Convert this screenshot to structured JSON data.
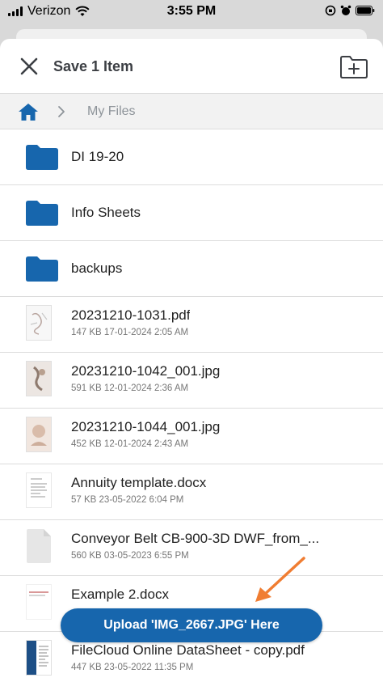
{
  "status": {
    "carrier": "Verizon",
    "time": "3:55 PM"
  },
  "header": {
    "title": "Save 1 Item"
  },
  "breadcrumb": {
    "current": "My Files"
  },
  "items": [
    {
      "type": "folder",
      "name": "DI 19-20",
      "meta": ""
    },
    {
      "type": "folder",
      "name": "Info Sheets",
      "meta": ""
    },
    {
      "type": "folder",
      "name": "backups",
      "meta": ""
    },
    {
      "type": "file",
      "name": "20231210-1031.pdf",
      "meta": "147 KB 17-01-2024 2:05 AM"
    },
    {
      "type": "file",
      "name": "20231210-1042_001.jpg",
      "meta": "591 KB 12-01-2024 2:36 AM"
    },
    {
      "type": "file",
      "name": "20231210-1044_001.jpg",
      "meta": "452 KB 12-01-2024 2:43 AM"
    },
    {
      "type": "file",
      "name": "Annuity template.docx",
      "meta": "57 KB 23-05-2022 6:04 PM"
    },
    {
      "type": "file",
      "name": "Conveyor Belt CB-900-3D DWF_from_...",
      "meta": "560 KB 03-05-2023 6:55 PM"
    },
    {
      "type": "file",
      "name": "Example 2.docx",
      "meta": ""
    },
    {
      "type": "file",
      "name": "FileCloud Online DataSheet - copy.pdf",
      "meta": "447 KB 23-05-2022 11:35 PM"
    }
  ],
  "upload_button": {
    "label": "Upload 'IMG_2667.JPG' Here"
  },
  "colors": {
    "accent": "#1766ad",
    "annotation_arrow": "#f07d32"
  }
}
